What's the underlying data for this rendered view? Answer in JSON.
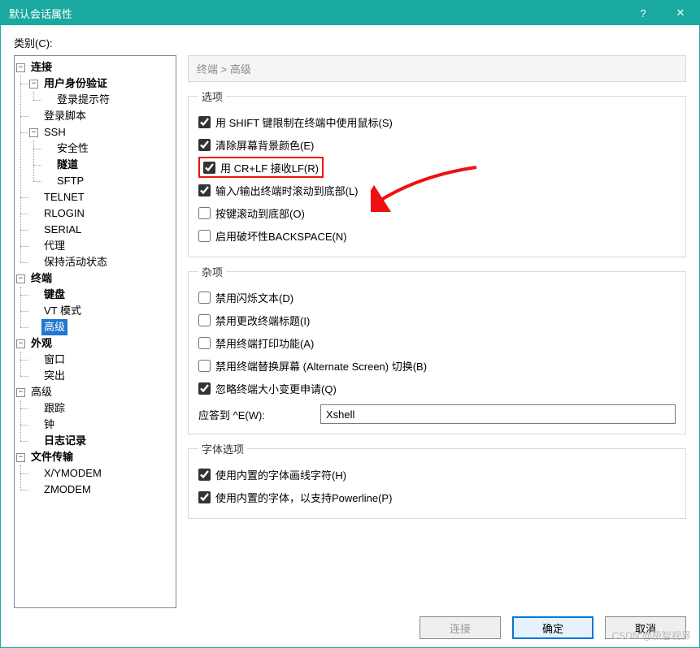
{
  "window": {
    "title": "默认会话属性",
    "help": "?",
    "close": "✕"
  },
  "category_label": "类别(C):",
  "breadcrumb": "终端 > 高级",
  "tree": {
    "connection": "连接",
    "auth": "用户身份验证",
    "login_prompt": "登录提示符",
    "login_script": "登录脚本",
    "ssh": "SSH",
    "security": "安全性",
    "tunnel": "隧道",
    "sftp": "SFTP",
    "telnet": "TELNET",
    "rlogin": "RLOGIN",
    "serial": "SERIAL",
    "proxy": "代理",
    "keepalive": "保持活动状态",
    "terminal": "终端",
    "keyboard": "键盘",
    "vt_mode": "VT 模式",
    "advanced": "高级",
    "appearance": "外观",
    "window_": "窗口",
    "highlight": "突出",
    "advanced2": "高级",
    "trace": "跟踪",
    "bell": "钟",
    "logging": "日志记录",
    "file_transfer": "文件传输",
    "xymodem": "X/YMODEM",
    "zmodem": "ZMODEM"
  },
  "options": {
    "legend": "选项",
    "shift_mouse": "用 SHIFT 键限制在终端中使用鼠标(S)",
    "clear_bg": "清除屏幕背景颜色(E)",
    "crlf": "用 CR+LF 接收LF(R)",
    "scroll_io": "输入/输出终端时滚动到底部(L)",
    "scroll_key": "按键滚动到底部(O)",
    "dest_backspace": "启用破坏性BACKSPACE(N)"
  },
  "misc": {
    "legend": "杂项",
    "disable_blink": "禁用闪烁文本(D)",
    "disable_title": "禁用更改终端标题(I)",
    "disable_print": "禁用终端打印功能(A)",
    "disable_altscreen": "禁用终端替换屏幕 (Alternate Screen) 切换(B)",
    "ignore_resize": "忽略终端大小变更申请(Q)",
    "answerback_label": "应答到 ^E(W):",
    "answerback_value": "Xshell"
  },
  "fonts": {
    "legend": "字体选项",
    "builtin_linedraw": "使用内置的字体画线字符(H)",
    "builtin_powerline": "使用内置的字体，以支持Powerline(P)"
  },
  "buttons": {
    "connect": "连接",
    "ok": "确定",
    "cancel": "取消"
  },
  "watermark": "CSDN @极智视界"
}
